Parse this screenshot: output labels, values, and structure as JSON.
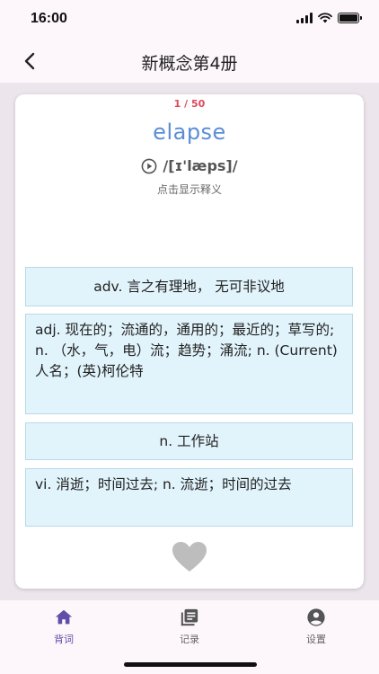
{
  "status_bar": {
    "time": "16:00"
  },
  "header": {
    "title": "新概念第4册",
    "back_icon": "chevron-left-icon"
  },
  "card": {
    "progress": "1 / 50",
    "word": "elapse",
    "phonetic": "/[ɪ'læps]/",
    "hint": "点击显示释义",
    "options": [
      "adv. 言之有理地， 无可非议地",
      "adj. 现在的；流通的，通用的；最近的；草写的; n. （水，气，电）流；趋势；涌流; n. (Current)人名；(英)柯伦特",
      "n. 工作站",
      "vi. 消逝；时间过去; n. 流逝；时间的过去"
    ]
  },
  "tabs": [
    {
      "label": "背词",
      "icon": "home-icon",
      "active": true
    },
    {
      "label": "记录",
      "icon": "library-icon",
      "active": false
    },
    {
      "label": "设置",
      "icon": "account-icon",
      "active": false
    }
  ],
  "colors": {
    "accent": "#5f4fa8",
    "word": "#5b8dd6",
    "progress": "#e0475b",
    "option_bg": "#e1f3fb",
    "option_border": "#b9d9e8",
    "background": "#ece6ec"
  }
}
